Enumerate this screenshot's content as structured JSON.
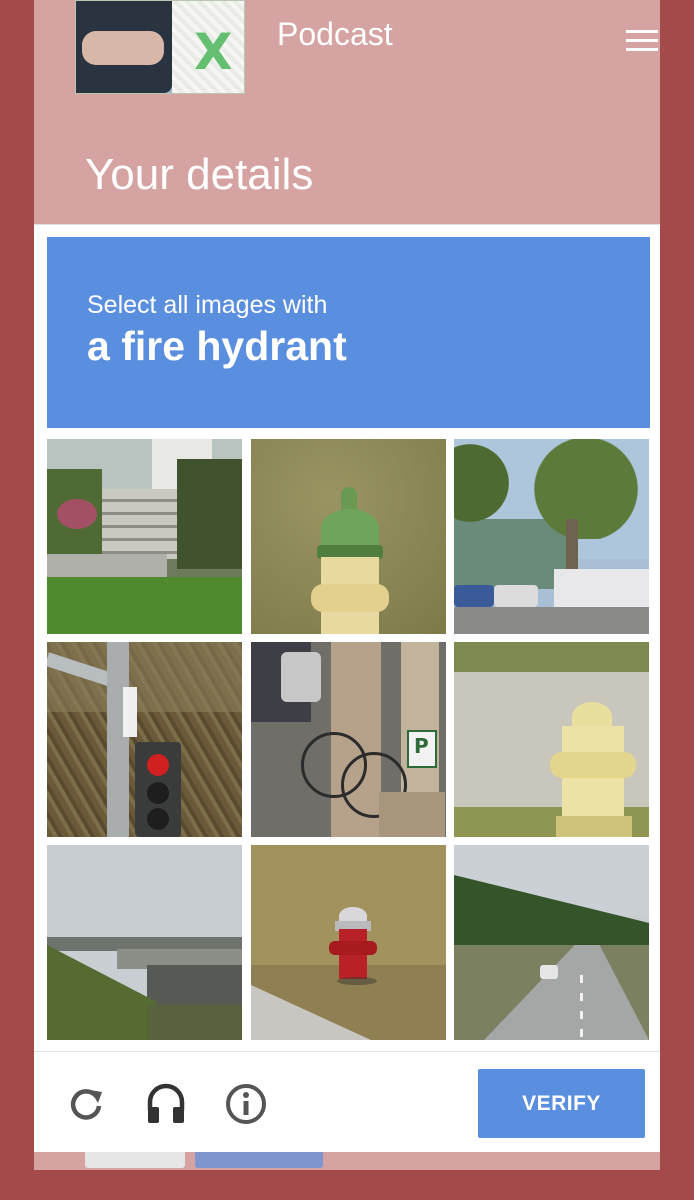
{
  "header": {
    "brand": "Podcast",
    "avatar_letter": "X"
  },
  "page": {
    "title": "Your details"
  },
  "captcha": {
    "instruction": "Select all images with",
    "target": "a fire hydrant",
    "tiles": [
      {
        "label": "house steps with bushes"
      },
      {
        "label": "yellow and green fire hydrant in grass"
      },
      {
        "label": "palm trees and parked cars"
      },
      {
        "label": "traffic light on pole"
      },
      {
        "label": "sidewalk with bicycles and parking sign"
      },
      {
        "label": "yellow fire hydrant by road"
      },
      {
        "label": "highway overpass"
      },
      {
        "label": "red fire hydrant on grass"
      },
      {
        "label": "highway road with trees"
      }
    ],
    "footer": {
      "reload_icon": "reload-icon",
      "audio_icon": "headphones-icon",
      "info_icon": "info-icon",
      "verify_label": "VERIFY"
    }
  },
  "colors": {
    "accent": "#5a8ede",
    "page_bg": "#d4a3a2",
    "frame": "#a44a4a"
  }
}
